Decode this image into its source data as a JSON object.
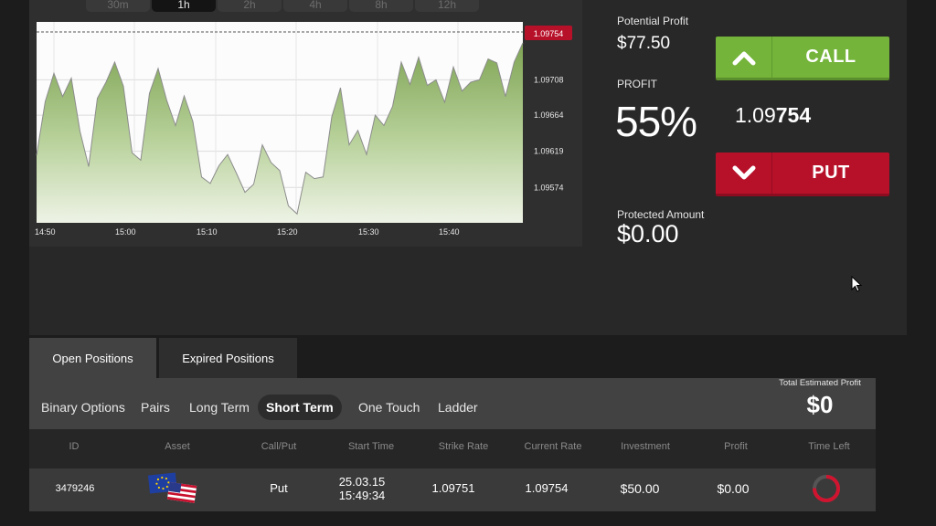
{
  "timeframes": [
    "30m",
    "1h",
    "2h",
    "4h",
    "8h",
    "12h"
  ],
  "active_timeframe": "1h",
  "chart": {
    "current_price_label": "1.09754",
    "y_ticks": [
      "1.09708",
      "1.09664",
      "1.09619",
      "1.09574"
    ],
    "x_ticks": [
      "14:50",
      "15:00",
      "15:10",
      "15:20",
      "15:30",
      "15:40"
    ]
  },
  "chart_data": {
    "type": "area",
    "y_ticks": [
      1.09708,
      1.09664,
      1.09619,
      1.09574
    ],
    "x_ticks": [
      "14:50",
      "15:00",
      "15:10",
      "15:20",
      "15:30",
      "15:40"
    ],
    "current_price": 1.09754,
    "ylim": [
      1.0953,
      1.0978
    ],
    "grid": true,
    "y": [
      1.09614,
      1.09681,
      1.09716,
      1.09687,
      1.0971,
      1.09644,
      1.096,
      1.09685,
      1.09705,
      1.0973,
      1.097,
      1.09617,
      1.09608,
      1.09691,
      1.09722,
      1.09682,
      1.09651,
      1.09688,
      1.09656,
      1.09587,
      1.09579,
      1.09601,
      1.09615,
      1.09592,
      1.09568,
      1.09578,
      1.09627,
      1.09605,
      1.09595,
      1.09551,
      1.09541,
      1.09593,
      1.09585,
      1.09587,
      1.09662,
      1.09698,
      1.09627,
      1.09645,
      1.09615,
      1.09664,
      1.09651,
      1.09675,
      1.0973,
      1.09702,
      1.09736,
      1.09701,
      1.09708,
      1.0968,
      1.09724,
      1.09694,
      1.09705,
      1.09708,
      1.09734,
      1.09729,
      1.09687,
      1.0973,
      1.09754
    ]
  },
  "panel": {
    "potential_profit_label": "Potential Profit",
    "potential_profit_value": "$77.50",
    "profit_label": "PROFIT",
    "profit_value": "55%",
    "rate_prefix": "1.09",
    "rate_suffix": "754",
    "protected_label": "Protected Amount",
    "protected_value": "$0.00",
    "call_label": "CALL",
    "put_label": "PUT"
  },
  "positions": {
    "tabs": [
      "Open Positions",
      "Expired Positions"
    ],
    "filters": [
      "Binary Options",
      "Pairs",
      "Long Term",
      "Short Term",
      "One Touch",
      "Ladder"
    ],
    "total_label": "Total Estimated Profit",
    "total_value": "$0",
    "columns": [
      "ID",
      "Asset",
      "Call/Put",
      "Start Time",
      "Strike Rate",
      "Current Rate",
      "Investment",
      "Profit",
      "Time Left"
    ],
    "rows": [
      {
        "id": "3479246",
        "asset": "eur-usd-flags",
        "call_put": "Put",
        "start_date": "25.03.15",
        "start_time": "15:49:34",
        "strike_rate": "1.09751",
        "current_rate": "1.09754",
        "investment": "$50.00",
        "profit": "$0.00",
        "time_left_fraction": 0.75
      }
    ]
  },
  "colors": {
    "call": "#74b43a",
    "put": "#b7112a",
    "chart_fill": "#8fb36a",
    "price_tag": "#b7112a"
  }
}
